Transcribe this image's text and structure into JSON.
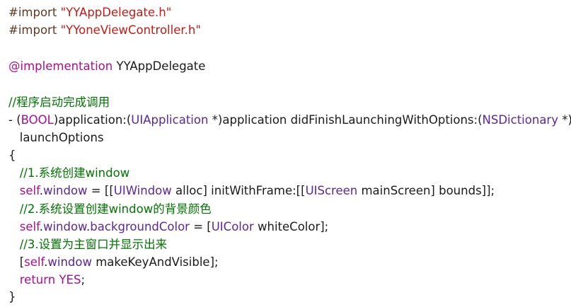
{
  "lines": [
    {
      "parts": [
        {
          "t": "#import ",
          "c": "p"
        },
        {
          "t": "\"YYAppDelegate.h\"",
          "c": "s"
        }
      ]
    },
    {
      "parts": [
        {
          "t": "#import ",
          "c": "p"
        },
        {
          "t": "\"YYoneViewController.h\"",
          "c": "s"
        }
      ]
    },
    {
      "parts": []
    },
    {
      "parts": [
        {
          "t": "@implementation ",
          "c": "kw"
        },
        {
          "t": "YYAppDelegate",
          "c": "pl"
        }
      ]
    },
    {
      "parts": []
    },
    {
      "parts": [
        {
          "t": "//程序启动完成调用",
          "c": "c"
        }
      ]
    },
    {
      "parts": [
        {
          "t": "- (",
          "c": "pl"
        },
        {
          "t": "BOOL",
          "c": "kw"
        },
        {
          "t": ")application:(",
          "c": "pl"
        },
        {
          "t": "UIApplication",
          "c": "t"
        },
        {
          "t": " *)application didFinishLaunchingWithOptions:(",
          "c": "pl"
        },
        {
          "t": "NSDictionary",
          "c": "t"
        },
        {
          "t": " *)",
          "c": "pl"
        }
      ]
    },
    {
      "parts": [
        {
          "t": "   launchOptions",
          "c": "pl"
        }
      ]
    },
    {
      "parts": [
        {
          "t": "{",
          "c": "pl"
        }
      ]
    },
    {
      "parts": [
        {
          "t": "   //1.系统创建window",
          "c": "c"
        }
      ]
    },
    {
      "parts": [
        {
          "t": "   ",
          "c": "pl"
        },
        {
          "t": "self",
          "c": "kw"
        },
        {
          "t": ".",
          "c": "pl"
        },
        {
          "t": "window",
          "c": "t"
        },
        {
          "t": " = [[",
          "c": "pl"
        },
        {
          "t": "UIWindow",
          "c": "t"
        },
        {
          "t": " alloc] initWithFrame:[[",
          "c": "pl"
        },
        {
          "t": "UIScreen",
          "c": "t"
        },
        {
          "t": " mainScreen] bounds]];",
          "c": "pl"
        }
      ]
    },
    {
      "parts": [
        {
          "t": "   //2.系统设置创建window的背景颜色",
          "c": "c"
        }
      ]
    },
    {
      "parts": [
        {
          "t": "   ",
          "c": "pl"
        },
        {
          "t": "self",
          "c": "kw"
        },
        {
          "t": ".",
          "c": "pl"
        },
        {
          "t": "window",
          "c": "t"
        },
        {
          "t": ".",
          "c": "pl"
        },
        {
          "t": "backgroundColor",
          "c": "t"
        },
        {
          "t": " = [",
          "c": "pl"
        },
        {
          "t": "UIColor",
          "c": "t"
        },
        {
          "t": " whiteColor];",
          "c": "pl"
        }
      ]
    },
    {
      "parts": [
        {
          "t": "   //3.设置为主窗口并显示出来",
          "c": "c"
        }
      ]
    },
    {
      "parts": [
        {
          "t": "   [",
          "c": "pl"
        },
        {
          "t": "self",
          "c": "kw"
        },
        {
          "t": ".",
          "c": "pl"
        },
        {
          "t": "window",
          "c": "t"
        },
        {
          "t": " makeKeyAndVisible];",
          "c": "pl"
        }
      ]
    },
    {
      "parts": [
        {
          "t": "   ",
          "c": "pl"
        },
        {
          "t": "return",
          "c": "kw"
        },
        {
          "t": " ",
          "c": "pl"
        },
        {
          "t": "YES",
          "c": "kw"
        },
        {
          "t": ";",
          "c": "pl"
        }
      ]
    },
    {
      "parts": [
        {
          "t": "}",
          "c": "pl"
        }
      ]
    }
  ]
}
